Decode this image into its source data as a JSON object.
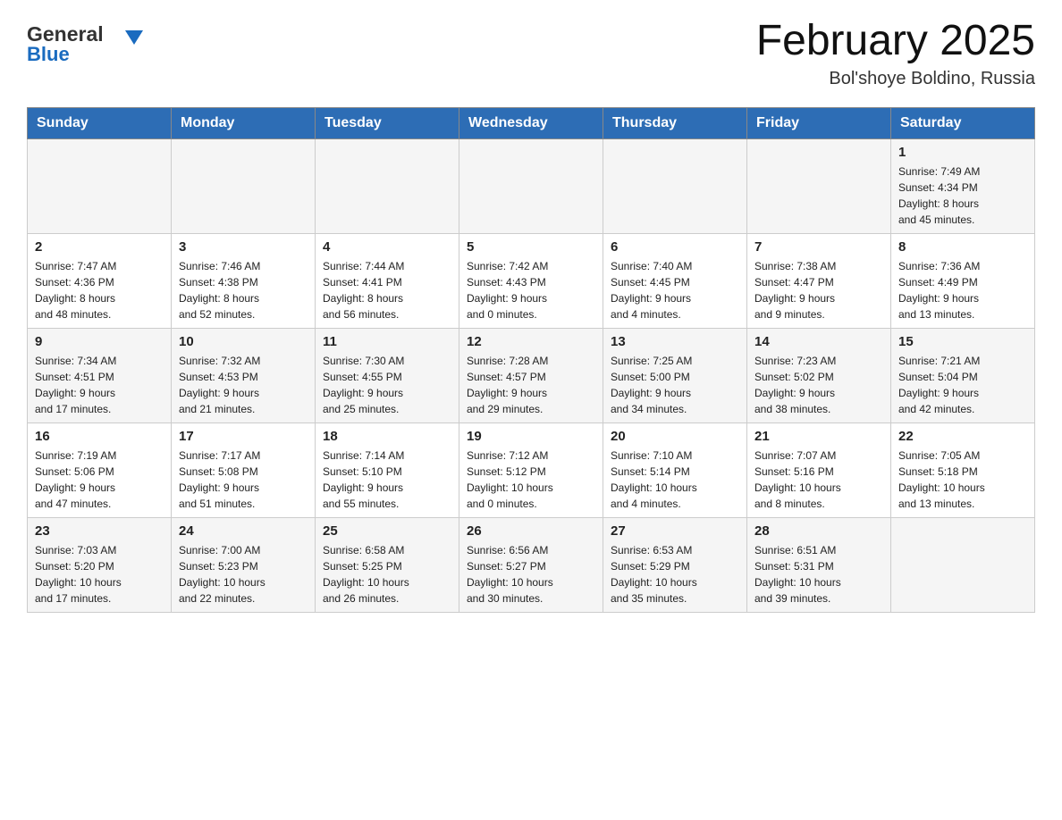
{
  "logo": {
    "text_general": "General",
    "text_blue": "Blue"
  },
  "title": "February 2025",
  "subtitle": "Bol'shoye Boldino, Russia",
  "days_of_week": [
    "Sunday",
    "Monday",
    "Tuesday",
    "Wednesday",
    "Thursday",
    "Friday",
    "Saturday"
  ],
  "weeks": [
    [
      {
        "day": "",
        "info": ""
      },
      {
        "day": "",
        "info": ""
      },
      {
        "day": "",
        "info": ""
      },
      {
        "day": "",
        "info": ""
      },
      {
        "day": "",
        "info": ""
      },
      {
        "day": "",
        "info": ""
      },
      {
        "day": "1",
        "info": "Sunrise: 7:49 AM\nSunset: 4:34 PM\nDaylight: 8 hours\nand 45 minutes."
      }
    ],
    [
      {
        "day": "2",
        "info": "Sunrise: 7:47 AM\nSunset: 4:36 PM\nDaylight: 8 hours\nand 48 minutes."
      },
      {
        "day": "3",
        "info": "Sunrise: 7:46 AM\nSunset: 4:38 PM\nDaylight: 8 hours\nand 52 minutes."
      },
      {
        "day": "4",
        "info": "Sunrise: 7:44 AM\nSunset: 4:41 PM\nDaylight: 8 hours\nand 56 minutes."
      },
      {
        "day": "5",
        "info": "Sunrise: 7:42 AM\nSunset: 4:43 PM\nDaylight: 9 hours\nand 0 minutes."
      },
      {
        "day": "6",
        "info": "Sunrise: 7:40 AM\nSunset: 4:45 PM\nDaylight: 9 hours\nand 4 minutes."
      },
      {
        "day": "7",
        "info": "Sunrise: 7:38 AM\nSunset: 4:47 PM\nDaylight: 9 hours\nand 9 minutes."
      },
      {
        "day": "8",
        "info": "Sunrise: 7:36 AM\nSunset: 4:49 PM\nDaylight: 9 hours\nand 13 minutes."
      }
    ],
    [
      {
        "day": "9",
        "info": "Sunrise: 7:34 AM\nSunset: 4:51 PM\nDaylight: 9 hours\nand 17 minutes."
      },
      {
        "day": "10",
        "info": "Sunrise: 7:32 AM\nSunset: 4:53 PM\nDaylight: 9 hours\nand 21 minutes."
      },
      {
        "day": "11",
        "info": "Sunrise: 7:30 AM\nSunset: 4:55 PM\nDaylight: 9 hours\nand 25 minutes."
      },
      {
        "day": "12",
        "info": "Sunrise: 7:28 AM\nSunset: 4:57 PM\nDaylight: 9 hours\nand 29 minutes."
      },
      {
        "day": "13",
        "info": "Sunrise: 7:25 AM\nSunset: 5:00 PM\nDaylight: 9 hours\nand 34 minutes."
      },
      {
        "day": "14",
        "info": "Sunrise: 7:23 AM\nSunset: 5:02 PM\nDaylight: 9 hours\nand 38 minutes."
      },
      {
        "day": "15",
        "info": "Sunrise: 7:21 AM\nSunset: 5:04 PM\nDaylight: 9 hours\nand 42 minutes."
      }
    ],
    [
      {
        "day": "16",
        "info": "Sunrise: 7:19 AM\nSunset: 5:06 PM\nDaylight: 9 hours\nand 47 minutes."
      },
      {
        "day": "17",
        "info": "Sunrise: 7:17 AM\nSunset: 5:08 PM\nDaylight: 9 hours\nand 51 minutes."
      },
      {
        "day": "18",
        "info": "Sunrise: 7:14 AM\nSunset: 5:10 PM\nDaylight: 9 hours\nand 55 minutes."
      },
      {
        "day": "19",
        "info": "Sunrise: 7:12 AM\nSunset: 5:12 PM\nDaylight: 10 hours\nand 0 minutes."
      },
      {
        "day": "20",
        "info": "Sunrise: 7:10 AM\nSunset: 5:14 PM\nDaylight: 10 hours\nand 4 minutes."
      },
      {
        "day": "21",
        "info": "Sunrise: 7:07 AM\nSunset: 5:16 PM\nDaylight: 10 hours\nand 8 minutes."
      },
      {
        "day": "22",
        "info": "Sunrise: 7:05 AM\nSunset: 5:18 PM\nDaylight: 10 hours\nand 13 minutes."
      }
    ],
    [
      {
        "day": "23",
        "info": "Sunrise: 7:03 AM\nSunset: 5:20 PM\nDaylight: 10 hours\nand 17 minutes."
      },
      {
        "day": "24",
        "info": "Sunrise: 7:00 AM\nSunset: 5:23 PM\nDaylight: 10 hours\nand 22 minutes."
      },
      {
        "day": "25",
        "info": "Sunrise: 6:58 AM\nSunset: 5:25 PM\nDaylight: 10 hours\nand 26 minutes."
      },
      {
        "day": "26",
        "info": "Sunrise: 6:56 AM\nSunset: 5:27 PM\nDaylight: 10 hours\nand 30 minutes."
      },
      {
        "day": "27",
        "info": "Sunrise: 6:53 AM\nSunset: 5:29 PM\nDaylight: 10 hours\nand 35 minutes."
      },
      {
        "day": "28",
        "info": "Sunrise: 6:51 AM\nSunset: 5:31 PM\nDaylight: 10 hours\nand 39 minutes."
      },
      {
        "day": "",
        "info": ""
      }
    ]
  ]
}
